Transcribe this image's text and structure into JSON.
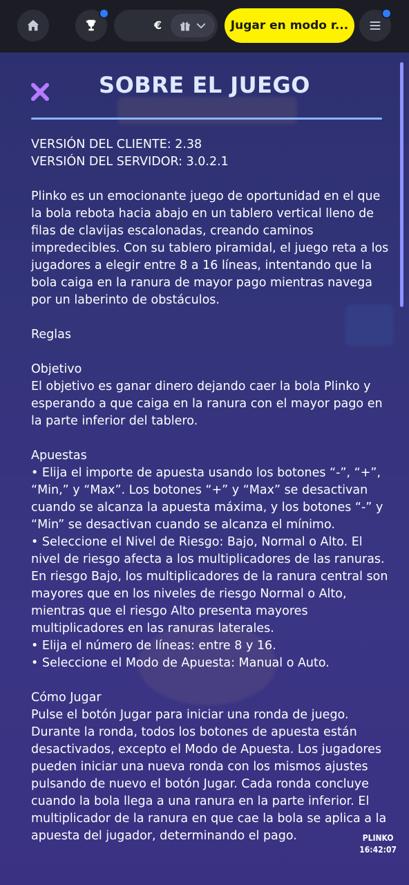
{
  "topbar": {
    "currency_symbol": "€",
    "play_button_label": "Jugar en modo r..."
  },
  "modal": {
    "title": "SOBRE EL JUEGO",
    "client_version": "VERSIÓN DEL CLIENTE: 2.38",
    "server_version": "VERSIÓN DEL SERVIDOR: 3.0.2.1",
    "intro": "Plinko es un emocionante juego de oportunidad en el que la bola rebota hacia abajo en un tablero vertical lleno de filas de clavijas escalonadas, creando caminos impredecibles. Con su tablero piramidal, el juego reta a los jugadores a elegir entre 8 a 16 líneas, intentando que la bola caiga en la ranura de mayor pago mientras navega por un laberinto de obstáculos.",
    "rules_heading": "Reglas",
    "objective_heading": "Objetivo",
    "objective_text": "El objetivo es ganar dinero dejando caer la bola Plinko y esperando a que caiga en la ranura con el mayor pago en la parte inferior del tablero.",
    "bets_heading": "Apuestas",
    "bets_items": [
      "• Elija el importe de apuesta usando los botones “-”, “+”, “Min,” y “Max”. Los botones “+” y “Max” se desactivan cuando se alcanza la apuesta máxima, y los botones “-” y “Min” se desactivan cuando se alcanza el mínimo.",
      "• Seleccione el Nivel de Riesgo: Bajo, Normal o Alto. El nivel de riesgo afecta a los multiplicadores de las ranuras. En riesgo Bajo, los multiplicadores de la ranura central son mayores que en los niveles de riesgo Normal o Alto, mientras que el riesgo Alto presenta mayores multiplicadores en las ranuras laterales.",
      "• Elija el número de líneas: entre 8 y 16.",
      "• Seleccione el Modo de Apuesta: Manual o Auto."
    ],
    "howto_heading": "Cómo Jugar",
    "howto_text": "Pulse el botón Jugar para iniciar una ronda de juego. Durante la ronda, todos los botones de apuesta están desactivados, excepto el Modo de Apuesta. Los jugadores pueden iniciar una nueva ronda con los mismos ajustes pulsando de nuevo el botón Jugar. Cada ronda concluye cuando la bola llega a una ranura en la parte inferior. El multiplicador de la ranura en que cae la bola se aplica a la apuesta del jugador, determinando el pago."
  },
  "footer": {
    "game_name": "PLINKO",
    "time": "16:42:07"
  },
  "colors": {
    "accent_yellow": "#fff200",
    "close_icon": "#b77bff",
    "title": "#dfe9ff",
    "notification_dot": "#2f7bff"
  },
  "icons": [
    "home-icon",
    "trophy-icon",
    "gift-icon",
    "chevron-down-icon",
    "menu-icon",
    "close-icon"
  ]
}
